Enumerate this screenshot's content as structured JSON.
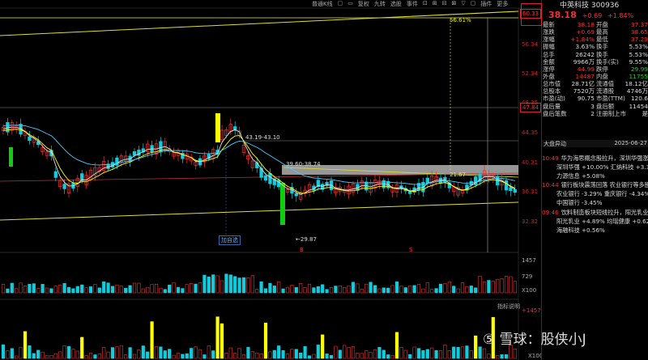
{
  "toolbar": [
    "普通K线",
    "▢",
    "▭",
    "复权",
    "九转",
    "选股",
    "事件",
    "⊡",
    "⊞",
    "⊟",
    "⊠",
    "▽",
    "▢",
    "插件",
    "更多"
  ],
  "price_axis": [
    "60.33",
    "56.34",
    "52.34",
    "48.35",
    "47.84",
    "44.35",
    "40.31",
    "36.31",
    "32.32"
  ],
  "volume_axis": {
    "top": "1457",
    "mid": "729",
    "unit": "X100"
  },
  "indicator": {
    "label": "指标说明",
    "top": "+1457150",
    "unit": "X100"
  },
  "annotations": {
    "high_pct": "56.61%",
    "range1": "43.19-43.10",
    "range2": "39.60-38.74",
    "low": "←29.87",
    "mid_pct": "21.67",
    "tag": "加自选",
    "marker_b": "B",
    "marker_s": "S"
  },
  "stock": {
    "name": "中英科技",
    "code": "300936",
    "price": "38.18",
    "change": "+0.69",
    "pct": "+1.84%"
  },
  "quote_rows": [
    {
      "l1": "最新",
      "v1": "38.18",
      "c1": "red",
      "l2": "开盘",
      "v2": "37.37",
      "c2": "red"
    },
    {
      "l1": "涨跌",
      "v1": "+0.69",
      "c1": "red",
      "l2": "最高",
      "v2": "38.65",
      "c2": "red"
    },
    {
      "l1": "涨幅",
      "v1": "+1.84%",
      "c1": "red",
      "l2": "最低",
      "v2": "37.29",
      "c2": "red"
    },
    {
      "l1": "振幅",
      "v1": "3.63%",
      "c1": "white",
      "l2": "换手",
      "v2": "5.53%",
      "c2": "white"
    },
    {
      "l1": "总手",
      "v1": "26242",
      "c1": "white",
      "l2": "换手",
      "v2": "5.53%",
      "c2": "white"
    },
    {
      "l1": "金额",
      "v1": "9966万",
      "c1": "white",
      "l2": "换手(实)",
      "v2": "9.55%",
      "c2": "white"
    },
    {
      "l1": "涨停",
      "v1": "44.99",
      "c1": "red",
      "l2": "跌停",
      "v2": "29.99",
      "c2": "green"
    },
    {
      "l1": "外盘",
      "v1": "14487",
      "c1": "red",
      "l2": "内盘",
      "v2": "11755",
      "c2": "green"
    },
    {
      "l1": "总市值",
      "v1": "28.71亿",
      "c1": "white",
      "l2": "流通值",
      "v2": "18.12亿",
      "c2": "white"
    },
    {
      "l1": "总股本",
      "v1": "7520万",
      "c1": "white",
      "l2": "流通股",
      "v2": "4746万",
      "c2": "white"
    },
    {
      "l1": "市盈(动)",
      "v1": "90.75",
      "c1": "white",
      "l2": "市盈(TTM)",
      "v2": "120.6",
      "c2": "white"
    },
    {
      "l1": "盘后量",
      "v1": "3",
      "c1": "white",
      "l2": "盘后额",
      "v2": "11454",
      "c2": "white"
    },
    {
      "l1": "盘后笔数",
      "v1": "2",
      "c1": "white",
      "l2": "注册制上市",
      "v2": "是",
      "c2": "white"
    }
  ],
  "news_header": {
    "left": "大盘异动",
    "right": "2025-06-27"
  },
  "news": [
    {
      "t": "10:49",
      "text": "华为海思概念股拉升，深圳华强涨"
    },
    {
      "t": "",
      "text": "深圳华强 +10.00%  汇纳科技 +3.35%"
    },
    {
      "t": "",
      "text": "力源信息 +5.08%"
    },
    {
      "t": "10:44",
      "text": "银行板块震荡回落 农业银行等多股"
    },
    {
      "t": "",
      "text": "农业银行 -3.29%  重庆银行 -4.34%"
    },
    {
      "t": "",
      "text": "中国银行 -3.45%"
    },
    {
      "t": "09:46",
      "text": "饮料制造板块短线拉升，阳光乳业"
    },
    {
      "t": "",
      "text": "阳光乳业 +4.89%  均瑶健康 +0.62%"
    },
    {
      "t": "",
      "text": "海融科技 +0.56%"
    }
  ],
  "watermark": "⑤ 雪球：股侠小J",
  "colors": {
    "up": "#e33",
    "down": "#1cd",
    "limit_up": "#ff0",
    "limit_down": "#1c1",
    "ma5": "#ddd",
    "ma10": "#ff0",
    "ma20": "#f0f",
    "ma60": "#4cf"
  }
}
